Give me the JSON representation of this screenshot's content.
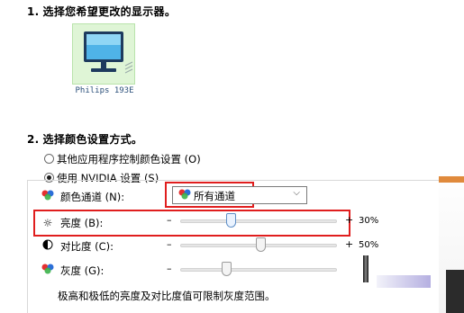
{
  "step1": {
    "number": "1.",
    "title": "选择您希望更改的显示器。"
  },
  "monitor": {
    "name": "Philips 193E",
    "icon": "monitor-icon"
  },
  "step2": {
    "number": "2.",
    "title": "选择颜色设置方式。"
  },
  "radio_other": {
    "label": "其他应用程序控制颜色设置 (O)",
    "selected": false
  },
  "radio_nvidia": {
    "label": "使用 NVIDIA 设置 (S)",
    "selected": true
  },
  "channel": {
    "label": "颜色通道 (N):",
    "value": "所有通道",
    "icon": "color-channel-icon"
  },
  "brightness": {
    "label": "亮度 (B):",
    "minus": "–",
    "plus": "+",
    "value_text": "30%",
    "value": 30,
    "icon": "sun-icon"
  },
  "contrast": {
    "label": "对比度 (C):",
    "minus": "–",
    "plus": "+",
    "value_text": "50%",
    "value": 50,
    "icon": "contrast-icon"
  },
  "gamma": {
    "label": "灰度 (G):",
    "minus": "–",
    "icon": "gamma-icon",
    "value": 40
  },
  "note": "极高和极低的亮度及对比度值可限制灰度范围。",
  "colors": {
    "highlight": "#e01e1e",
    "tile": "#dff5d6"
  }
}
